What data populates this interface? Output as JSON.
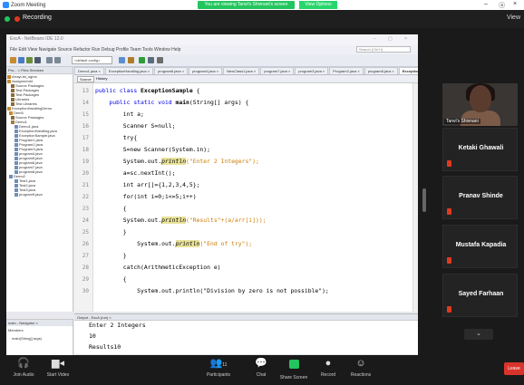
{
  "window": {
    "title": "Zoom Meeting",
    "share_banner": "You are viewing Tanvi's Shivnani's screen",
    "view_options": "View Options",
    "minimize": "–",
    "restore": "ⓐ",
    "close": "×"
  },
  "recording": {
    "label": "Recording",
    "view": "View"
  },
  "netbeans": {
    "title": "ExcA - NetBeans IDE 12.0",
    "menu": "File  Edit  View  Navigate  Source  Refactor  Run  Debug  Profile  Team  Tools  Window  Help",
    "search_placeholder": "Search (Ctrl+I)",
    "config_combo": "<default config>",
    "project_tabs": "Pro... × Files  Services",
    "projects": [
      "ArrayList_sgms",
      "Assignment4",
      "Source Packages",
      "Test Packages",
      "Test Packages",
      "Libraries",
      "Test Libraries",
      "ExceptionHandlingDemo",
      "Dem5",
      "Source Packages",
      "Demo1",
      "Demo1.java",
      "ExceptionHandling.java",
      "ExceptionSample.java",
      "Program1.java",
      "Program2.java",
      "Program3.java",
      "program4.java",
      "program5.java",
      "program6.java",
      "program7.java",
      "program8.java",
      "Demo2",
      "Test1.java",
      "Test2.java",
      "Test3.java",
      "program9.java"
    ],
    "navigator_title": "main - Navigator ×",
    "navigator_members": "Members",
    "navigator_item": "main(String[] args)",
    "editor_tabs": [
      "Demo1.java ×",
      "ExceptionHandling.java ×",
      "program6.java ×",
      "program4.java ×",
      "NewClass1.java ×",
      "program7.java ×",
      "program3.java ×",
      "Program2.java ×",
      "program8.java ×",
      "ExceptionSample.java ×"
    ],
    "editor_subtabs": [
      "Source",
      "History"
    ],
    "line_numbers": [
      "13",
      "14",
      "15",
      "16",
      "17",
      "18",
      "19",
      "20",
      "21",
      "22",
      "23",
      "24",
      "25",
      "26",
      "27",
      "28",
      "29",
      "30"
    ],
    "code": {
      "l13_kw": "public class ",
      "l13_name": "ExceptionSample",
      "l13_rest": " {",
      "l14_kw": "    public static void ",
      "l14_name": "main",
      "l14_rest": "(String[] args) {",
      "l15": "        int a;",
      "l16": "        Scanner S=null;",
      "l17": "        try{",
      "l18": "        S=new Scanner(System.in);",
      "l19_a": "        System.out.",
      "l19_fn": "println",
      "l19_str": "(\"Enter 2 Integers\");",
      "l20": "        a=sc.nextInt();",
      "l21": "        int arr[]={1,2,3,4,5};",
      "l22": "        for(int i=0;i<=5;i++)",
      "l23": "        {",
      "l24_a": "        System.out.",
      "l24_fn": "println",
      "l24_str": "(\"Results\"+(a/arr[i]));",
      "l25": "        }",
      "l26_a": "            System.out.",
      "l26_fn": "println",
      "l26_str": "(\"End of try\");",
      "l27": "        }",
      "l28": "        catch(ArithmeticException e)",
      "l29": "        {",
      "l30": "            System.out.println(\"Division by zero is not possible\");"
    },
    "output_tab": "Output - ExcA (run) ×",
    "output_lines": [
      "Enter 2 Integers",
      "10",
      "Results10"
    ],
    "status_pos": "INS"
  },
  "participants": [
    {
      "name": "Tanvi's Shivnani",
      "video": true
    },
    {
      "name": "Ketaki Ghawali"
    },
    {
      "name": "Pranav Shinde"
    },
    {
      "name": "Mustafa Kapadia"
    },
    {
      "name": "Sayed Farhaan"
    }
  ],
  "toolbar": {
    "audio": "Join Audio",
    "video": "Start Video",
    "participants": "Participants",
    "participants_count": "11",
    "chat": "Chat",
    "share": "Share Screen",
    "record": "Record",
    "reactions": "Reactions",
    "leave": "Leave"
  },
  "colors": {
    "zoom_blue": "#2d8cff",
    "share_green": "#23c55e",
    "leave_red": "#d9342b",
    "mic_off_red": "#e0391f"
  }
}
